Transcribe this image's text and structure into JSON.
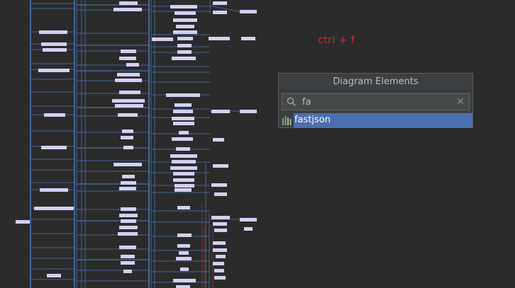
{
  "shortcut_hint": "ctrl + f",
  "popup": {
    "title": "Diagram Elements",
    "search_value": "fa",
    "clear_icon": "close-icon",
    "search_icon": "search-icon",
    "results": [
      {
        "label": "fastjson",
        "icon": "module-icon",
        "selected": true
      }
    ]
  },
  "colors": {
    "canvas_background": "#2b2b2b",
    "node_fill": "#d4d0f5",
    "edge_blue": "#4a78b8",
    "edge_red": "#8b3a3a",
    "selection": "#4b6eaf",
    "hint_text": "#d32f2f"
  }
}
